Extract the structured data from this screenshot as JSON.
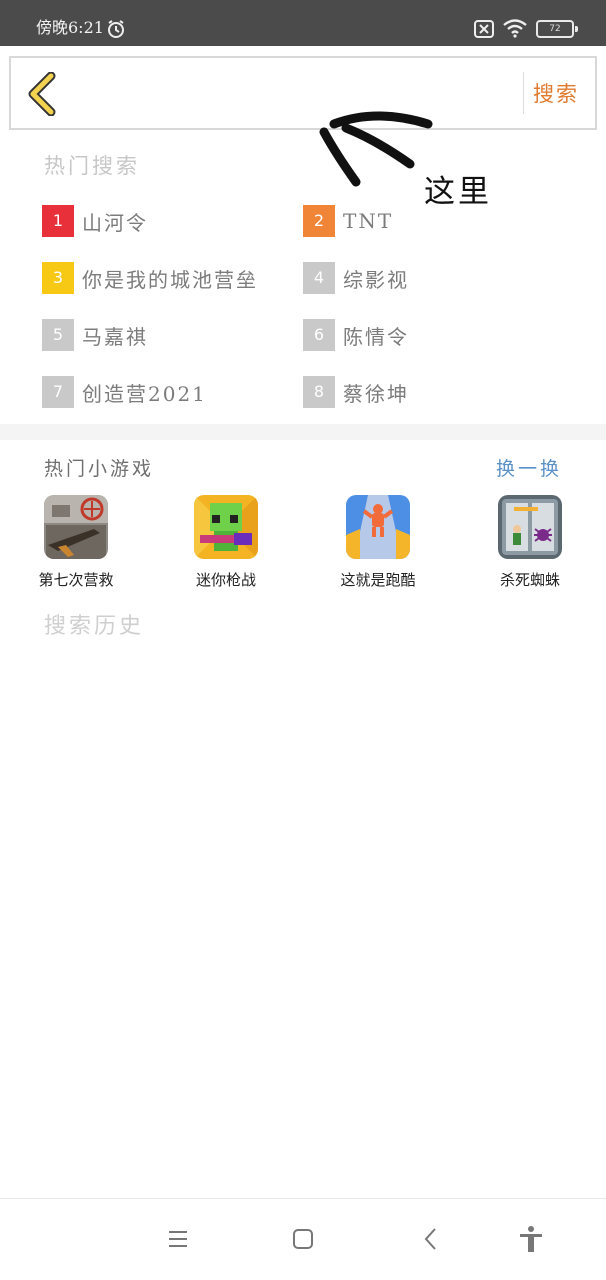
{
  "status_bar": {
    "time": "傍晚6:21",
    "battery_level": "72",
    "icons": [
      "alarm-icon",
      "sim-off-icon",
      "wifi-icon",
      "battery-icon"
    ]
  },
  "search_bar": {
    "placeholder": "",
    "search_label": "搜索"
  },
  "annotation": {
    "text": "这里"
  },
  "hot_search": {
    "title": "热门搜索",
    "items": [
      {
        "rank": "1",
        "label": "山河令",
        "color": "#e8303a"
      },
      {
        "rank": "2",
        "label": "TNT",
        "color": "#f08437"
      },
      {
        "rank": "3",
        "label": "你是我的城池营垒",
        "color": "#f7c915"
      },
      {
        "rank": "4",
        "label": "综影视",
        "color": "#c9c9c9"
      },
      {
        "rank": "5",
        "label": "马嘉祺",
        "color": "#c9c9c9"
      },
      {
        "rank": "6",
        "label": "陈情令",
        "color": "#c9c9c9"
      },
      {
        "rank": "7",
        "label": "创造营2021",
        "color": "#c9c9c9"
      },
      {
        "rank": "8",
        "label": "蔡徐坤",
        "color": "#c9c9c9"
      }
    ]
  },
  "games": {
    "title": "热门小游戏",
    "refresh_label": "换一换",
    "items": [
      {
        "label": "第七次营救",
        "icon": "soldier-game-icon"
      },
      {
        "label": "迷你枪战",
        "icon": "blocky-gun-game-icon"
      },
      {
        "label": "这就是跑酷",
        "icon": "runner-game-icon"
      },
      {
        "label": "杀死蜘蛛",
        "icon": "spider-game-icon"
      }
    ]
  },
  "history": {
    "title": "搜索历史"
  },
  "nav_bar": {
    "icons": [
      "menu-icon",
      "home-icon",
      "back-icon",
      "accessibility-icon"
    ]
  },
  "colors": {
    "accent_orange": "#e07a2f",
    "link_blue": "#5a92c8",
    "back_arrow_yellow": "#f3d250"
  }
}
